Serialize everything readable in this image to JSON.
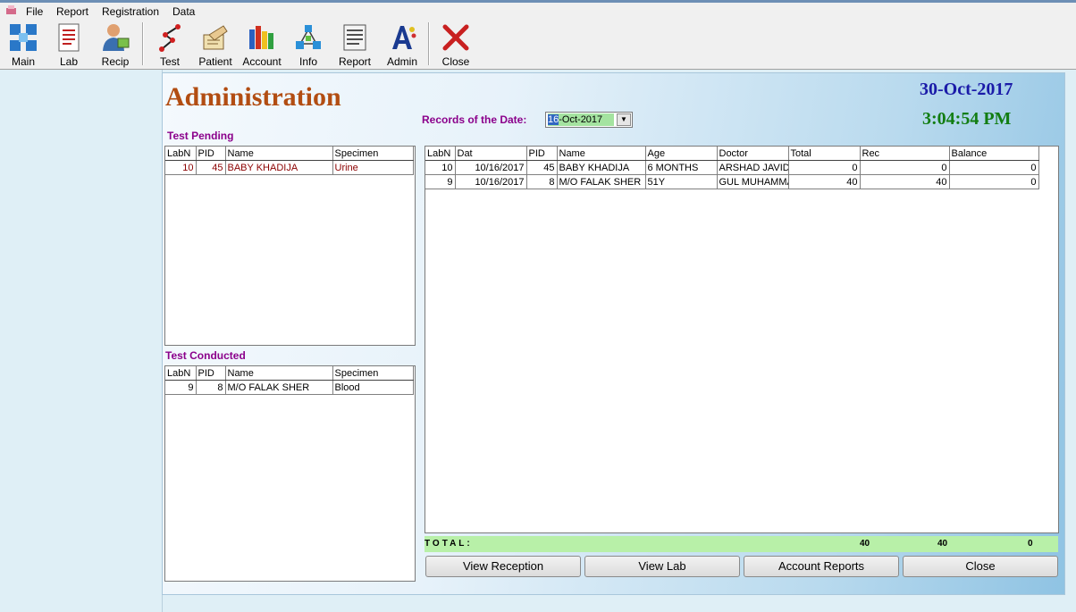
{
  "menu": [
    "File",
    "Report",
    "Registration",
    "Data"
  ],
  "toolbar": [
    {
      "label": "Main",
      "icon": "main-grid-icon"
    },
    {
      "label": "Lab",
      "icon": "lab-document-icon"
    },
    {
      "label": "Recip",
      "icon": "reception-user-icon"
    },
    {
      "label": "Test",
      "icon": "test-icon"
    },
    {
      "label": "Patient",
      "icon": "patient-icon"
    },
    {
      "label": "Account",
      "icon": "account-books-icon"
    },
    {
      "label": "Info",
      "icon": "info-network-icon"
    },
    {
      "label": "Report",
      "icon": "report-scroll-icon"
    },
    {
      "label": "Admin",
      "icon": "admin-letter-icon"
    },
    {
      "label": "Close",
      "icon": "close-x-icon"
    }
  ],
  "form": {
    "title": "Administration",
    "date": "30-Oct-2017",
    "time": "3:04:54 PM",
    "records_label": "Records of the Date:",
    "date_picker": {
      "day": "16",
      "rest": "-Oct-2017"
    }
  },
  "test_pending": {
    "label": "Test Pending",
    "columns": [
      "LabN",
      "PID",
      "Name",
      "Specimen"
    ],
    "rows": [
      {
        "labn": "10",
        "pid": "45",
        "name": "BABY KHADIJA",
        "specimen": "Urine"
      }
    ]
  },
  "test_conducted": {
    "label": "Test Conducted",
    "columns": [
      "LabN",
      "PID",
      "Name",
      "Specimen"
    ],
    "rows": [
      {
        "labn": "9",
        "pid": "8",
        "name": "M/O FALAK SHER",
        "specimen": "Blood"
      }
    ]
  },
  "records": {
    "columns": [
      "LabN",
      "Dat",
      "PID",
      "Name",
      "Age",
      "Doctor",
      "Total",
      "Rec",
      "Balance"
    ],
    "rows": [
      {
        "labn": "10",
        "dat": "10/16/2017",
        "pid": "45",
        "name": "BABY KHADIJA",
        "age": "6 MONTHS",
        "doctor": "ARSHAD JAVID",
        "total": "0",
        "rec": "0",
        "balance": "0"
      },
      {
        "labn": "9",
        "dat": "10/16/2017",
        "pid": "8",
        "name": "M/O FALAK SHER",
        "age": "51Y",
        "doctor": "GUL MUHAMMAD",
        "total": "40",
        "rec": "40",
        "balance": "0"
      }
    ]
  },
  "totals": {
    "label": "TOTAL:",
    "total": "40",
    "rec": "40",
    "balance": "0"
  },
  "buttons": {
    "view_reception": "View Reception",
    "view_lab": "View Lab",
    "account_reports": "Account Reports",
    "close": "Close"
  },
  "colors": {
    "title": "#b24d12",
    "date": "#1a1aa8",
    "time": "#127d12",
    "section": "#8b008b",
    "total_bar": "#b8f0a8"
  }
}
